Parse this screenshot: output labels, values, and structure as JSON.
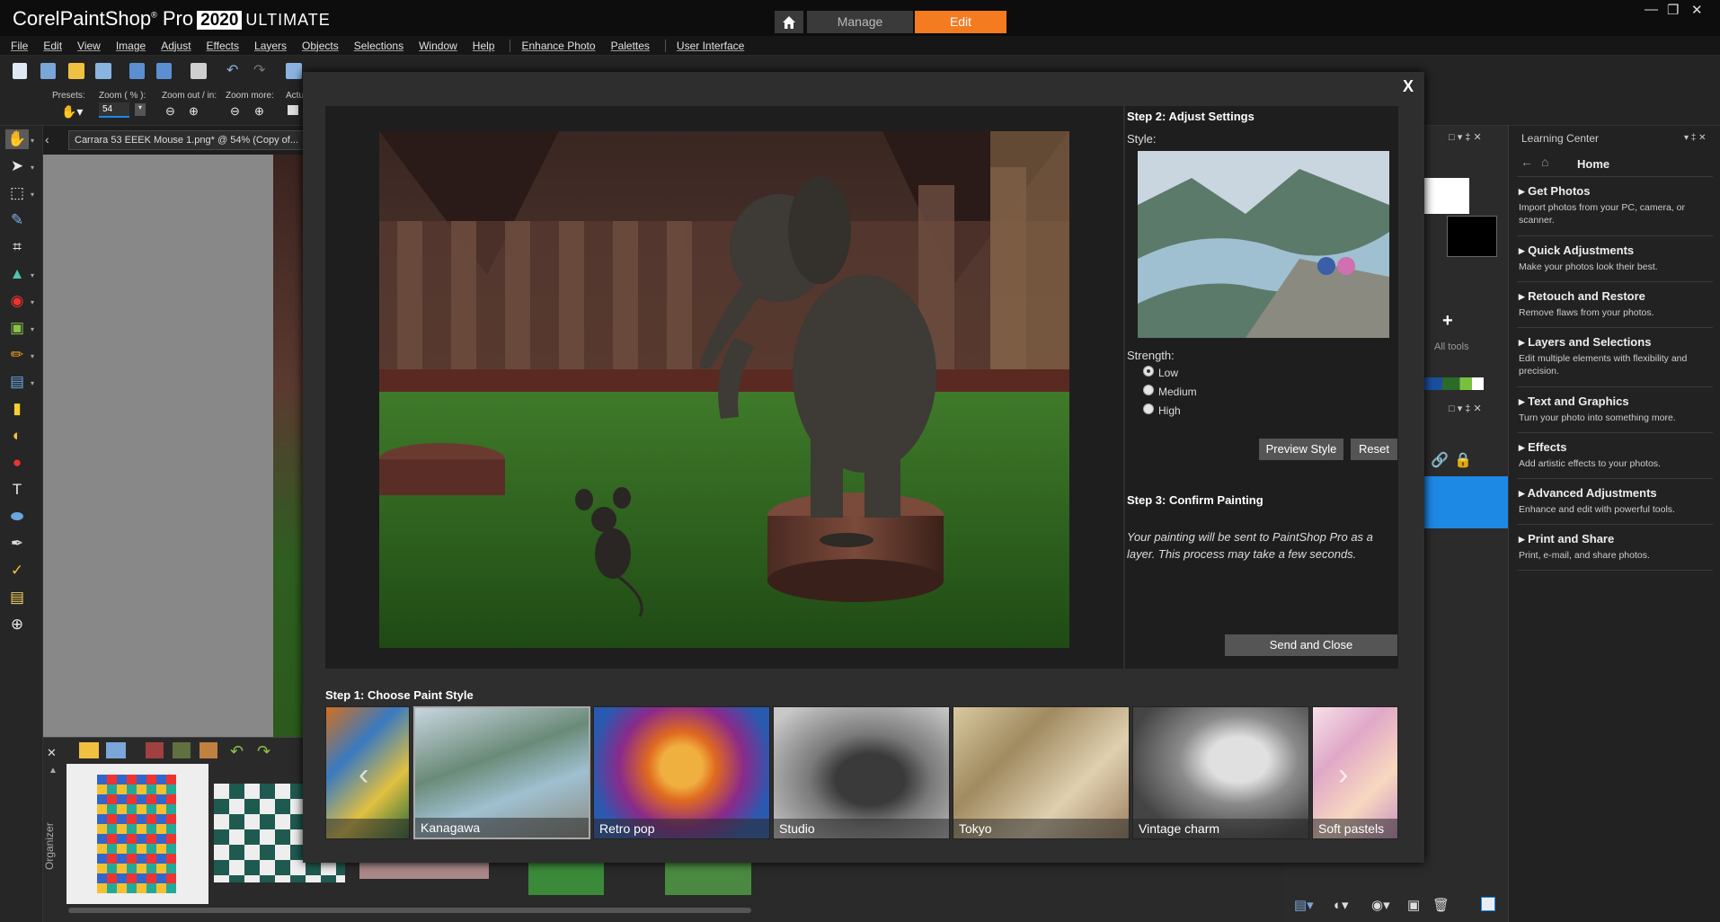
{
  "app": {
    "brand_corel": "Corel",
    "brand_name": "PaintShop",
    "brand_pro": "Pro",
    "brand_year": "2020",
    "brand_edition": "ULTIMATE"
  },
  "workspace_tabs": {
    "manage": "Manage",
    "edit": "Edit"
  },
  "menu": [
    "File",
    "Edit",
    "View",
    "Image",
    "Adjust",
    "Effects",
    "Layers",
    "Objects",
    "Selections",
    "Window",
    "Help",
    "Enhance Photo",
    "Palettes",
    "User Interface"
  ],
  "options_bar": {
    "presets_label": "Presets:",
    "zoom_label": "Zoom ( % ):",
    "zoom_value": "54",
    "zoom_out_label": "Zoom out / in:",
    "zoom_more_label": "Zoom more:",
    "actual_label": "Actu"
  },
  "document": {
    "tab_title": "Carrara 53 EEEK Mouse 1.png* @  54% (Copy of..."
  },
  "organizer": {
    "label": "Organizer"
  },
  "right_panel": {
    "all_tools": "All tools"
  },
  "learning_center": {
    "title": "Learning Center",
    "home": "Home",
    "sections": [
      {
        "title": "Get Photos",
        "desc": "Import photos from your PC, camera, or scanner."
      },
      {
        "title": "Quick Adjustments",
        "desc": "Make your photos look their best."
      },
      {
        "title": "Retouch and Restore",
        "desc": "Remove flaws from your photos."
      },
      {
        "title": "Layers and Selections",
        "desc": "Edit multiple elements with flexibility and precision."
      },
      {
        "title": "Text and Graphics",
        "desc": "Turn your photo into something more."
      },
      {
        "title": "Effects",
        "desc": "Add artistic effects to your photos."
      },
      {
        "title": "Advanced Adjustments",
        "desc": "Enhance and edit with powerful tools."
      },
      {
        "title": "Print and Share",
        "desc": "Print, e-mail, and share photos."
      }
    ]
  },
  "dialog": {
    "close": "X",
    "step2_title": "Step 2: Adjust Settings",
    "style_label": "Style:",
    "strength_label": "Strength:",
    "strength_options": [
      "Low",
      "Medium",
      "High"
    ],
    "strength_selected": "Low",
    "preview_btn": "Preview Style",
    "reset_btn": "Reset",
    "step3_title": "Step 3: Confirm Painting",
    "step3_desc": "Your painting will be sent to PaintShop Pro as a layer. This process may take a few seconds.",
    "send_btn": "Send and Close",
    "step1_title": "Step 1: Choose Paint Style",
    "styles": [
      "",
      "Kanagawa",
      "Retro pop",
      "Studio",
      "Tokyo",
      "Vintage charm",
      "Soft pastels"
    ],
    "selected_style": "Kanagawa"
  },
  "colors": {
    "accent": "#f47b20",
    "layer_highlight": "#1e88e5"
  }
}
